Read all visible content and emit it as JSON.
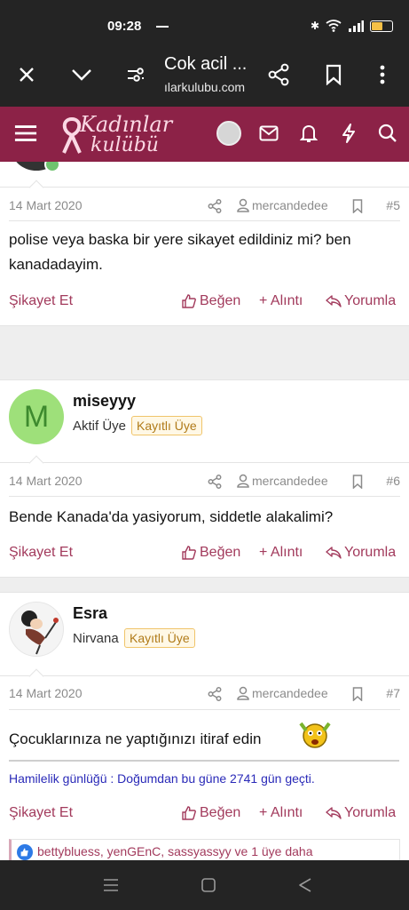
{
  "status_bar": {
    "time": "09:28"
  },
  "browser": {
    "title": "Cok acil ...",
    "url": "ılarkulubu.com"
  },
  "site": {
    "logo_line1": "Kadınlar",
    "logo_line2": "kulübü"
  },
  "posts": [
    {
      "number": "#5",
      "date": "14 Mart 2020",
      "author_link": "mercandedee",
      "text": "polise veya baska bir yere sikayet edildiniz mi? ben kanadadayim.",
      "report": "Şikayet Et",
      "like": "Beğen",
      "quote": "+ Alıntı",
      "reply": "Yorumla"
    },
    {
      "user": {
        "name": "miseyyy",
        "title": "Aktif Üye",
        "badge": "Kayıtlı Üye",
        "avatar_letter": "M"
      },
      "number": "#6",
      "date": "14 Mart 2020",
      "author_link": "mercandedee",
      "text": "Bende Kanada'da yasiyorum, siddetle alakalimi?",
      "report": "Şikayet Et",
      "like": "Beğen",
      "quote": "+ Alıntı",
      "reply": "Yorumla"
    },
    {
      "user": {
        "name": "Esra",
        "title": "Nirvana",
        "badge": "Kayıtlı Üye"
      },
      "number": "#7",
      "date": "14 Mart 2020",
      "author_link": "mercandedee",
      "text": "Çocuklarınıza ne yaptığınızı itiraf edin",
      "signature": "Hamilelik günlüğü : Doğumdan bu güne 2741 gün geçti.",
      "report": "Şikayet Et",
      "like": "Beğen",
      "quote": "+ Alıntı",
      "reply": "Yorumla",
      "reactions": "bettybluess, yenGEnC, sassyassyy ve 1 üye daha"
    }
  ],
  "colors": {
    "brand": "#8c2247",
    "action": "#a23a5c",
    "chrome": "#242424",
    "signature": "#2a2ab8",
    "avatar_green": "#9ee07a"
  }
}
